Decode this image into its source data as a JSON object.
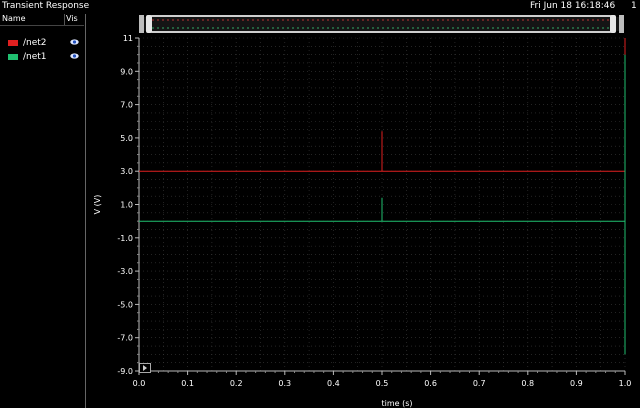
{
  "app": {
    "title": "Transient Response",
    "timestamp": "Fri Jun 18 16:18:46",
    "page": "1"
  },
  "sidebar": {
    "col_name": "Name",
    "col_vis": "Vis",
    "signals": [
      {
        "label": "/net2",
        "color": "#e02020",
        "visible": true
      },
      {
        "label": "/net1",
        "color": "#20c070",
        "visible": true
      }
    ]
  },
  "chart_data": {
    "type": "line",
    "xlabel": "time (s)",
    "ylabel": "V (V)",
    "xlim": [
      0.0,
      1.0
    ],
    "ylim": [
      -9.0,
      11.0
    ],
    "xticks": [
      "0.0",
      "0.1",
      "0.2",
      "0.3",
      "0.4",
      "0.5",
      "0.6",
      "0.7",
      "0.8",
      "0.9",
      "1.0"
    ],
    "yticks": [
      "11",
      "9.0",
      "7.0",
      "5.0",
      "3.0",
      "1.0",
      "-1.0",
      "-3.0",
      "-5.0",
      "-7.0",
      "-9.0"
    ],
    "grid": true,
    "series": [
      {
        "name": "/net2",
        "color": "#e02020",
        "x": [
          0.0,
          0.5,
          0.5,
          0.5,
          1.0,
          1.0,
          1.0
        ],
        "y": [
          3.0,
          3.0,
          5.4,
          3.0,
          3.0,
          11.0,
          10.0
        ]
      },
      {
        "name": "/net1",
        "color": "#20c070",
        "x": [
          0.0,
          0.5,
          0.5,
          0.5,
          1.0,
          1.0,
          1.0
        ],
        "y": [
          0.0,
          0.0,
          1.4,
          0.0,
          0.0,
          10.0,
          -8.0
        ]
      }
    ]
  }
}
